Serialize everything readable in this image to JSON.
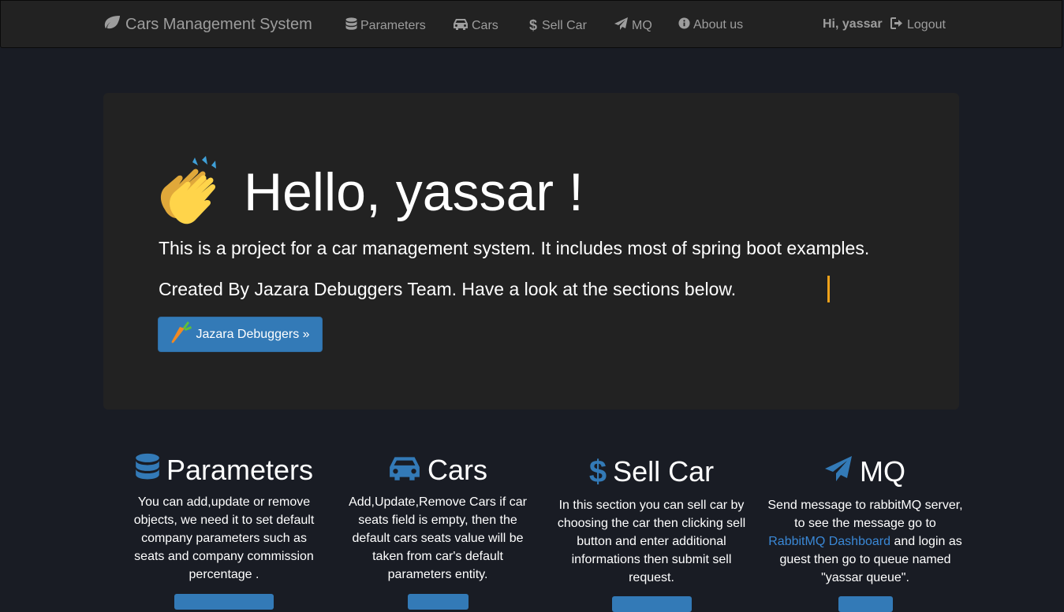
{
  "navbar": {
    "brand": "Cars Management System",
    "items": [
      {
        "label": "Parameters",
        "icon": "database-icon"
      },
      {
        "label": "Cars",
        "icon": "car-icon"
      },
      {
        "label": "Sell Car",
        "icon": "dollar-icon"
      },
      {
        "label": "MQ",
        "icon": "paper-plane-icon"
      },
      {
        "label": "About us",
        "icon": "info-circle-icon"
      }
    ],
    "greeting": "Hi, yassar",
    "logout": "Logout"
  },
  "jumbotron": {
    "heading": "Hello, yassar !",
    "line1": "This is a project for a car management system. It includes most of spring boot examples.",
    "line2": "Created By Jazara Debuggers Team. Have a look at the sections below.",
    "button": "Jazara Debuggers »"
  },
  "sections": [
    {
      "title": "Parameters",
      "text": "You can add,update or remove objects, we need it to set default company parameters such as seats and company commission percentage ."
    },
    {
      "title": "Cars",
      "text": "Add,Update,Remove Cars if car seats field is empty, then the default cars seats value will be taken from car's default parameters entity."
    },
    {
      "title": "Sell Car",
      "text": "In this section you can sell car by choosing the car then clicking sell button and enter additional informations then submit sell request."
    },
    {
      "title": "MQ",
      "text_before": "Send message to rabbitMQ server, to see the message go to",
      "link": "RabbitMQ Dashboard",
      "text_after": "and login as guest then go to queue named \"yassar queue\"."
    }
  ],
  "colors": {
    "accent": "#337ab7",
    "page_bg": "#191c24",
    "panel_bg": "#222222",
    "nav_text": "#9d9d9d",
    "cursor": "#f0a21a"
  }
}
